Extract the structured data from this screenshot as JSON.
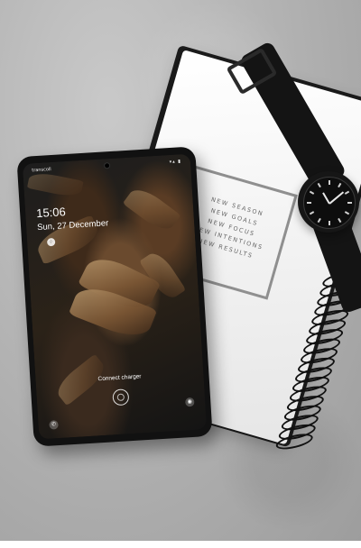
{
  "phone": {
    "status_left": "transcoll",
    "status_right": "▾▴ ▮",
    "time": "15:06",
    "date": "Sun, 27 December",
    "charger_text": "Connect charger"
  },
  "notebook": {
    "lines": [
      "NEW SEASON",
      "NEW GOALS",
      "NEW FOCUS",
      "NEW INTENTIONS",
      "NEW RESULTS"
    ]
  },
  "icons": {
    "fingerprint": "fingerprint-icon",
    "phone": "phone-icon",
    "camera": "camera-icon"
  }
}
